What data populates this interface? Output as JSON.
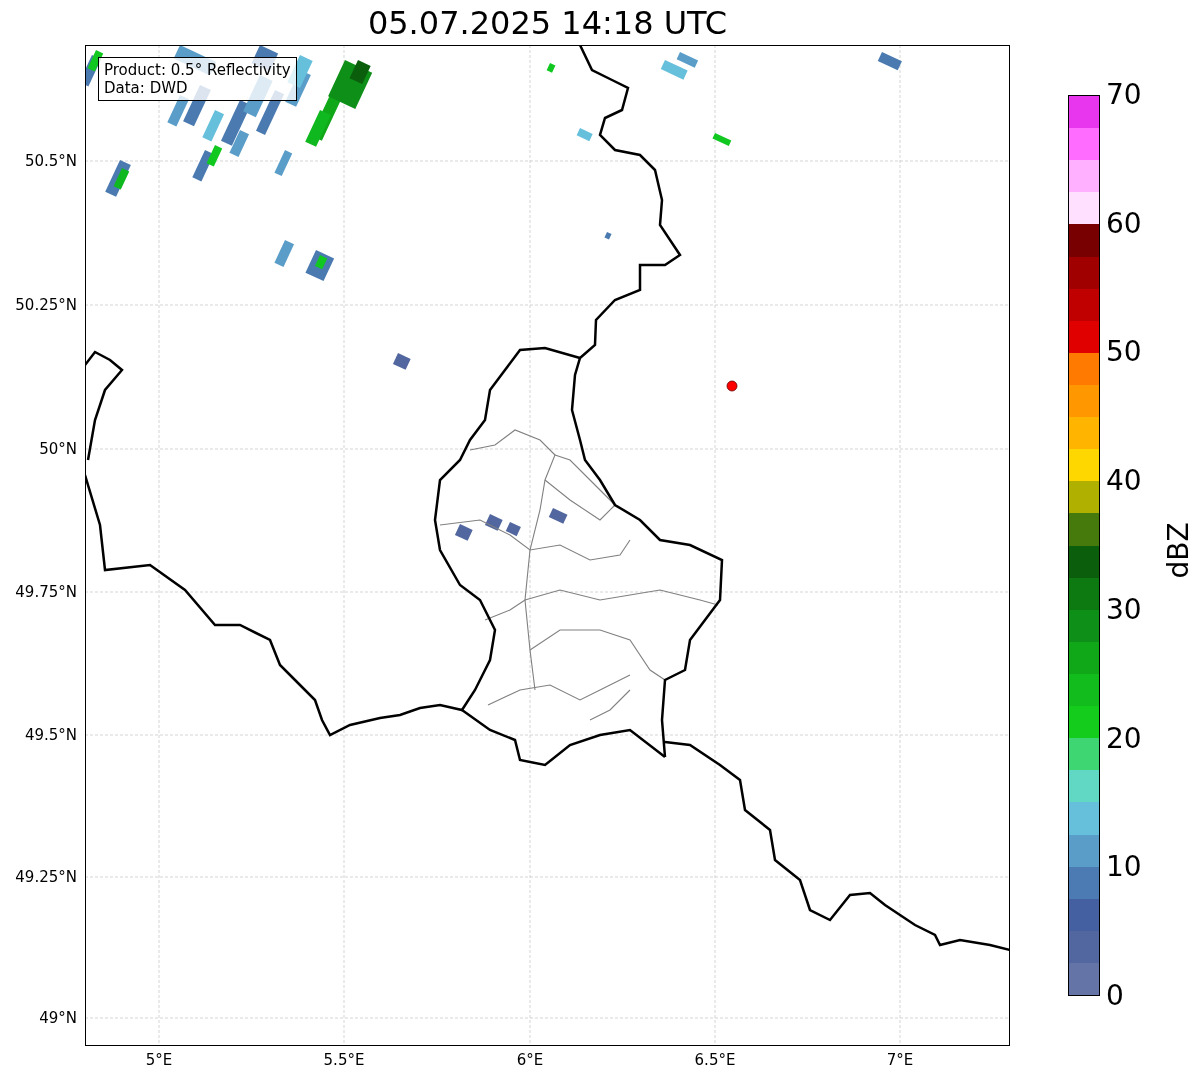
{
  "title": "05.07.2025 14:18 UTC",
  "info_box": {
    "lines": [
      "Product: 0.5° Reflectivity",
      "Data: DWD"
    ]
  },
  "map": {
    "lon_ticks": [
      "5°E",
      "5.5°E",
      "6°E",
      "6.5°E",
      "7°E"
    ],
    "lat_ticks": [
      "50.5°N",
      "50.25°N",
      "50°N",
      "49.75°N",
      "49.5°N",
      "49.25°N",
      "49°N"
    ]
  },
  "colorbar": {
    "label": "dBZ",
    "ticks": [
      "70",
      "60",
      "50",
      "40",
      "30",
      "20",
      "10",
      "0"
    ],
    "bands": [
      {
        "color": "#6574a6"
      },
      {
        "color": "#52679f"
      },
      {
        "color": "#4460a0"
      },
      {
        "color": "#4b7bb2"
      },
      {
        "color": "#5a9dc8"
      },
      {
        "color": "#66c0dc"
      },
      {
        "color": "#60d8c4"
      },
      {
        "color": "#3dd672"
      },
      {
        "color": "#14cc1c"
      },
      {
        "color": "#12bc1c"
      },
      {
        "color": "#10a818"
      },
      {
        "color": "#0e9018"
      },
      {
        "color": "#0c7a10"
      },
      {
        "color": "#0a5e0c"
      },
      {
        "color": "#467a0c"
      },
      {
        "color": "#b0b000"
      },
      {
        "color": "#ffd700"
      },
      {
        "color": "#ffb400"
      },
      {
        "color": "#ff9800"
      },
      {
        "color": "#ff7a00"
      },
      {
        "color": "#e00000"
      },
      {
        "color": "#c00000"
      },
      {
        "color": "#a00000"
      },
      {
        "color": "#780000"
      },
      {
        "color": "#ffe0ff"
      },
      {
        "color": "#ffb0ff"
      },
      {
        "color": "#ff6cff"
      },
      {
        "color": "#e836ee"
      }
    ]
  }
}
